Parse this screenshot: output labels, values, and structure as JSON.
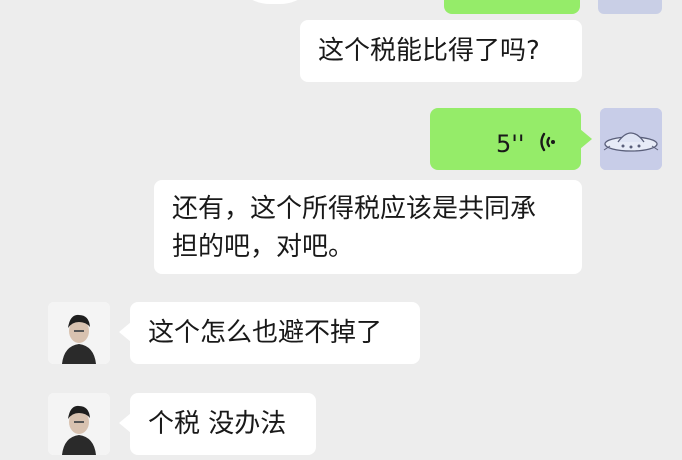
{
  "colors": {
    "background": "#ededed",
    "bubble_white": "#ffffff",
    "bubble_green": "#95ec69",
    "text": "#191919"
  },
  "messages": [
    {
      "id": "m1",
      "side": "right",
      "type": "text",
      "text": "这个税能比得了吗?"
    },
    {
      "id": "m2",
      "side": "right",
      "type": "voice",
      "duration": "5''",
      "icon": "voice-wave-icon"
    },
    {
      "id": "m3",
      "side": "right",
      "type": "text",
      "lines": [
        "还有，这个所得税应该是共同承",
        "担的吧，对吧。"
      ]
    },
    {
      "id": "m4",
      "side": "left",
      "type": "text",
      "text": "这个怎么也避不掉了"
    },
    {
      "id": "m5",
      "side": "left",
      "type": "text",
      "text": "个税 没办法"
    }
  ]
}
